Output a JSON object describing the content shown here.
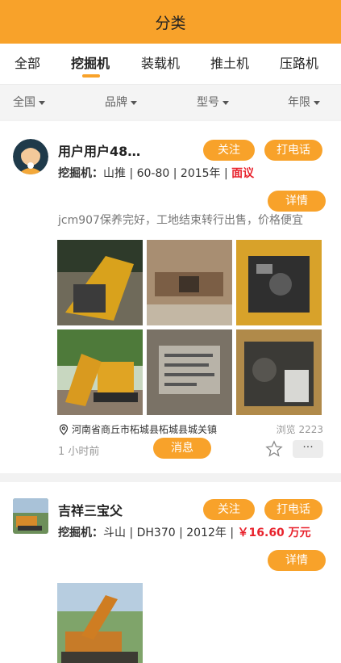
{
  "header": {
    "title": "分类"
  },
  "tabs": [
    {
      "label": "全部"
    },
    {
      "label": "挖掘机"
    },
    {
      "label": "装载机"
    },
    {
      "label": "推土机"
    },
    {
      "label": "压路机"
    }
  ],
  "active_tab": "挖掘机",
  "filters": [
    {
      "label": "全国"
    },
    {
      "label": "品牌"
    },
    {
      "label": "型号"
    },
    {
      "label": "年限"
    }
  ],
  "listings": [
    {
      "user": "用户用户48…",
      "follow_label": "关注",
      "call_label": "打电话",
      "spec_prefix": "挖掘机：",
      "spec_text": "山推 | 60-80 | 2015年 | ",
      "price": "面议",
      "detail_label": "详情",
      "description": "jcm907保养完好，工地结束转行出售，价格便宜",
      "location": "河南省商丘市柘城县柘城县城关镇",
      "views_label": "浏览",
      "views": "2223",
      "time": "1 小时前",
      "message_label": "消息",
      "more_label": "···"
    },
    {
      "user": "吉祥三宝父",
      "follow_label": "关注",
      "call_label": "打电话",
      "spec_prefix": "挖掘机：",
      "spec_text": "斗山 | DH370 | 2012年 | ",
      "price": "￥16.60 万元",
      "detail_label": "详情"
    }
  ],
  "colors": {
    "accent": "#f8a22a",
    "price_red": "#e8232d"
  },
  "icons": [
    "caret-down-icon",
    "location-pin-icon",
    "star-icon",
    "more-icon"
  ]
}
